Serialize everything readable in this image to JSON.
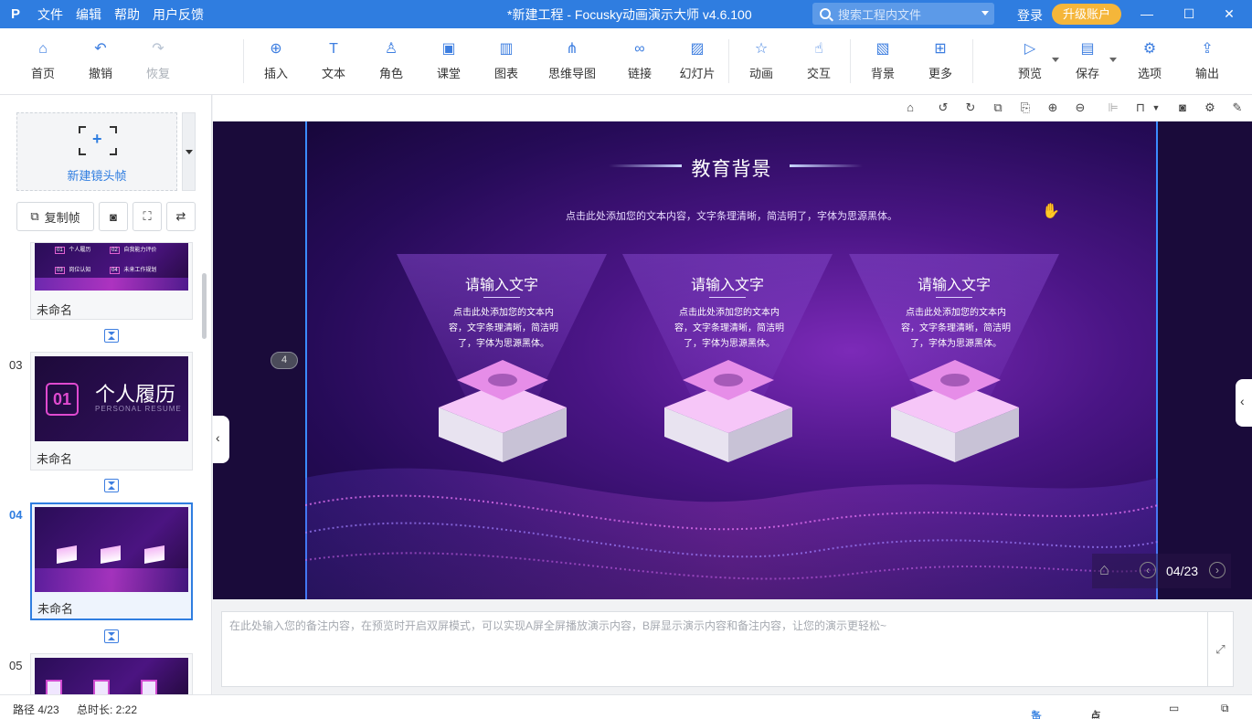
{
  "titlebar": {
    "logo": "P",
    "menu": [
      "文件",
      "编辑",
      "帮助",
      "用户反馈"
    ],
    "title": "*新建工程 - Focusky动画演示大师  v4.6.100",
    "search_placeholder": "搜索工程内文件",
    "login": "登录",
    "upgrade": "升级账户",
    "min_icon": "minimize-icon",
    "max_icon": "maximize-icon",
    "close_icon": "close-icon"
  },
  "toolbar": {
    "home": "首页",
    "undo": "撤销",
    "redo": "恢复",
    "insert": "插入",
    "text": "文本",
    "role": "角色",
    "class": "课堂",
    "chart": "图表",
    "mindmap": "思维导图",
    "link": "链接",
    "slideshow": "幻灯片",
    "animation": "动画",
    "interact": "交互",
    "background": "背景",
    "more": "更多",
    "preview": "预览",
    "save": "保存",
    "options": "选项",
    "export": "输出"
  },
  "left": {
    "new_frame": "新建镜头帧",
    "copy_frame": "复制帧",
    "frames": [
      {
        "num": "",
        "name": "未命名"
      },
      {
        "num": "03",
        "name": "未命名",
        "thumb_title": "个人履历",
        "thumb_badge": "01",
        "thumb_sub": "PERSONAL RESUME"
      },
      {
        "num": "04",
        "name": "未命名"
      },
      {
        "num": "05",
        "name": ""
      }
    ],
    "thumb02_items": [
      "个人履历",
      "自我能力评价",
      "岗位认知",
      "未来工作规划"
    ],
    "thumb02_badges": [
      "01",
      "02",
      "03",
      "04"
    ]
  },
  "slide": {
    "frame_badge": "4",
    "title": "教育背景",
    "subtitle": "点击此处添加您的文本内容，文字条理清晰，简洁明了，字体为思源黑体。",
    "columns": [
      {
        "heading": "请输入文字",
        "body": "点击此处添加您的文本内容，文字条理清晰，简洁明了，字体为思源黑体。"
      },
      {
        "heading": "请输入文字",
        "body": "点击此处添加您的文本内容，文字条理清晰，简洁明了，字体为思源黑体。"
      },
      {
        "heading": "请输入文字",
        "body": "点击此处添加您的文本内容，文字条理清晰，简洁明了，字体为思源黑体。"
      }
    ],
    "page_indicator": "04/23"
  },
  "notes": {
    "placeholder": "在此处输入您的备注内容，在预览时开启双屏模式，可以实现A屏全屏播放演示内容，B屏显示演示内容和备注内容，让您的演示更轻松~"
  },
  "status": {
    "path": "路径 4/23",
    "duration": "总时长: 2:22",
    "notes_btn": "备注",
    "rollcall_btn": "点名"
  }
}
